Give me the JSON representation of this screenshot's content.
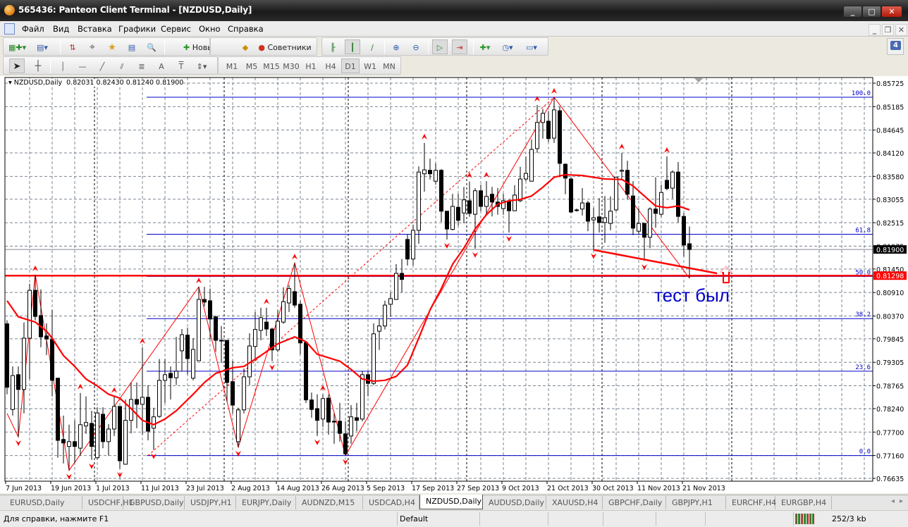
{
  "window": {
    "title": "565436: Panteon Client Terminal - [NZDUSD,Daily]",
    "minimize": "_",
    "maximize": "□",
    "close": "✕"
  },
  "menu": {
    "items": [
      "Файл",
      "Вид",
      "Вставка",
      "Графики",
      "Сервис",
      "Окно",
      "Справка"
    ],
    "mdi": [
      "_",
      "❐",
      "✕"
    ],
    "notification_count": "4"
  },
  "toolbar1": {
    "new_order": "Новый Ордер",
    "experts": "Советники"
  },
  "toolbar2": {
    "timeframes": [
      "M1",
      "M5",
      "M15",
      "M30",
      "H1",
      "H4",
      "D1",
      "W1",
      "MN"
    ],
    "active_timeframe": "D1",
    "text_tool": "A",
    "label_tool": "T"
  },
  "chart_header": {
    "symbol": "NZDUSD,Daily",
    "ohlc": "0.82031 0.82430 0.81240 0.81900"
  },
  "annotation": {
    "text": "тест был",
    "color": "#0000cc"
  },
  "tabs": [
    "EURUSD,Daily",
    "USDCHF,H1",
    "GBPUSD,Daily",
    "USDJPY,H1",
    "EURJPY,Daily",
    "AUDNZD,M15",
    "USDCAD,H4",
    "NZDUSD,Daily",
    "AUDUSD,Daily",
    "XAUUSD,H4",
    "GBPCHF,Daily",
    "GBPJPY,H1",
    "EURCHF,H4",
    "EURGBP,H4"
  ],
  "active_tab": "NZDUSD,Daily",
  "status": {
    "help": "Для справки, нажмите F1",
    "profile": "Default",
    "traffic": "252/3 kb"
  },
  "chart_data": {
    "type": "candlestick",
    "symbol": "NZDUSD",
    "timeframe": "Daily",
    "ylim": [
      0.76635,
      0.85725
    ],
    "y_ticks": [
      "0.85725",
      "0.85185",
      "0.84645",
      "0.84120",
      "0.83580",
      "0.83055",
      "0.82515",
      "0.81975",
      "0.81450",
      "0.80910",
      "0.80370",
      "0.79845",
      "0.79305",
      "0.78765",
      "0.78240",
      "0.77700",
      "0.77160",
      "0.76635"
    ],
    "x_labels": [
      {
        "bar": 0,
        "label": "7 Jun 2013"
      },
      {
        "bar": 8,
        "label": "19 Jun 2013"
      },
      {
        "bar": 16,
        "label": "1 Jul 2013"
      },
      {
        "bar": 24,
        "label": "11 Jul 2013"
      },
      {
        "bar": 32,
        "label": "23 Jul 2013"
      },
      {
        "bar": 40,
        "label": "2 Aug 2013"
      },
      {
        "bar": 48,
        "label": "14 Aug 2013"
      },
      {
        "bar": 56,
        "label": "26 Aug 2013"
      },
      {
        "bar": 64,
        "label": "5 Sep 2013"
      },
      {
        "bar": 72,
        "label": "17 Sep 2013"
      },
      {
        "bar": 80,
        "label": "27 Sep 2013"
      },
      {
        "bar": 88,
        "label": "9 Oct 2013"
      },
      {
        "bar": 96,
        "label": "21 Oct 2013"
      },
      {
        "bar": 104,
        "label": "30 Oct 2013"
      },
      {
        "bar": 112,
        "label": "11 Nov 2013"
      },
      {
        "bar": 120,
        "label": "21 Nov 2013"
      }
    ],
    "period_separator_bars": [
      16,
      39,
      61,
      82,
      106,
      129
    ],
    "ohlc": [
      [
        0.8019,
        0.8027,
        0.7857,
        0.7873
      ],
      [
        0.7822,
        0.7921,
        0.7808,
        0.79
      ],
      [
        0.7902,
        0.7921,
        0.7759,
        0.7868
      ],
      [
        0.7868,
        0.8022,
        0.7813,
        0.7986
      ],
      [
        0.7986,
        0.8111,
        0.7892,
        0.8096
      ],
      [
        0.8096,
        0.8132,
        0.8027,
        0.8036
      ],
      [
        0.8038,
        0.8098,
        0.7965,
        0.7989
      ],
      [
        0.7991,
        0.802,
        0.7947,
        0.7984
      ],
      [
        0.7983,
        0.8051,
        0.7852,
        0.7889
      ],
      [
        0.7894,
        0.7894,
        0.7711,
        0.7751
      ],
      [
        0.7753,
        0.7808,
        0.7698,
        0.7745
      ],
      [
        0.7737,
        0.7787,
        0.7682,
        0.7748
      ],
      [
        0.7748,
        0.7797,
        0.7699,
        0.7737
      ],
      [
        0.7733,
        0.786,
        0.7716,
        0.7787
      ],
      [
        0.7784,
        0.7852,
        0.7766,
        0.7792
      ],
      [
        0.779,
        0.7819,
        0.7706,
        0.7737
      ],
      [
        0.7711,
        0.7827,
        0.7707,
        0.7814
      ],
      [
        0.7811,
        0.7827,
        0.7733,
        0.7748
      ],
      [
        0.7748,
        0.7788,
        0.7716,
        0.7777
      ],
      [
        0.7777,
        0.7852,
        0.7761,
        0.7829
      ],
      [
        0.7829,
        0.7829,
        0.7686,
        0.7704
      ],
      [
        0.7696,
        0.7845,
        0.7695,
        0.7797
      ],
      [
        0.7797,
        0.7884,
        0.7767,
        0.7845
      ],
      [
        0.7845,
        0.7884,
        0.7779,
        0.7834
      ],
      [
        0.7834,
        0.7965,
        0.7764,
        0.785
      ],
      [
        0.785,
        0.7878,
        0.7751,
        0.7772
      ],
      [
        0.7779,
        0.7826,
        0.7729,
        0.7805
      ],
      [
        0.7806,
        0.7938,
        0.7803,
        0.7889
      ],
      [
        0.7889,
        0.7938,
        0.7837,
        0.7902
      ],
      [
        0.7905,
        0.7921,
        0.7845,
        0.7895
      ],
      [
        0.7895,
        0.7989,
        0.7878,
        0.791
      ],
      [
        0.7957,
        0.8007,
        0.791,
        0.7994
      ],
      [
        0.7993,
        0.801,
        0.7902,
        0.7939
      ],
      [
        0.7894,
        0.7986,
        0.7889,
        0.796
      ],
      [
        0.7934,
        0.8104,
        0.7934,
        0.8075
      ],
      [
        0.8075,
        0.8104,
        0.8059,
        0.8069
      ],
      [
        0.8072,
        0.81,
        0.7983,
        0.803
      ],
      [
        0.8035,
        0.8038,
        0.7955,
        0.7981
      ],
      [
        0.7981,
        0.8014,
        0.7929,
        0.798
      ],
      [
        0.7981,
        0.7981,
        0.784,
        0.7884
      ],
      [
        0.7886,
        0.7934,
        0.7813,
        0.7832
      ],
      [
        0.7748,
        0.7826,
        0.7735,
        0.7821
      ],
      [
        0.7821,
        0.7916,
        0.7813,
        0.7897
      ],
      [
        0.7897,
        0.7997,
        0.7878,
        0.7968
      ],
      [
        0.7967,
        0.8046,
        0.7933,
        0.8006
      ],
      [
        0.8004,
        0.8056,
        0.7981,
        0.8033
      ],
      [
        0.8023,
        0.8056,
        0.7991,
        0.8007
      ],
      [
        0.8007,
        0.801,
        0.7933,
        0.7959
      ],
      [
        0.7959,
        0.8051,
        0.7954,
        0.8025
      ],
      [
        0.8023,
        0.8103,
        0.8019,
        0.807
      ],
      [
        0.8067,
        0.8108,
        0.8046,
        0.81
      ],
      [
        0.8093,
        0.8159,
        0.8056,
        0.8062
      ],
      [
        0.8064,
        0.8072,
        0.7949,
        0.7975
      ],
      [
        0.7976,
        0.7978,
        0.7837,
        0.7844
      ],
      [
        0.7844,
        0.7861,
        0.7803,
        0.7822
      ],
      [
        0.7824,
        0.7857,
        0.7761,
        0.7797
      ],
      [
        0.78,
        0.7857,
        0.7782,
        0.7847
      ],
      [
        0.7848,
        0.7857,
        0.7764,
        0.7793
      ],
      [
        0.7795,
        0.7813,
        0.7743,
        0.7793
      ],
      [
        0.7795,
        0.7837,
        0.7748,
        0.7767
      ],
      [
        0.7766,
        0.7795,
        0.7716,
        0.772
      ],
      [
        0.7761,
        0.7832,
        0.7743,
        0.7805
      ],
      [
        0.7803,
        0.7837,
        0.7772,
        0.7797
      ],
      [
        0.78,
        0.791,
        0.7795,
        0.7902
      ],
      [
        0.7902,
        0.791,
        0.7852,
        0.7882
      ],
      [
        0.7882,
        0.802,
        0.7878,
        0.7996
      ],
      [
        0.8002,
        0.803,
        0.7959,
        0.8014
      ],
      [
        0.8014,
        0.8072,
        0.8006,
        0.8062
      ],
      [
        0.8064,
        0.809,
        0.8036,
        0.8077
      ],
      [
        0.8075,
        0.8156,
        0.8074,
        0.8135
      ],
      [
        0.8135,
        0.8168,
        0.8091,
        0.8121
      ],
      [
        0.8213,
        0.8224,
        0.8153,
        0.8168
      ],
      [
        0.8168,
        0.8247,
        0.8153,
        0.8234
      ],
      [
        0.8234,
        0.8381,
        0.8203,
        0.8368
      ],
      [
        0.8364,
        0.8435,
        0.8323,
        0.8373
      ],
      [
        0.8372,
        0.8399,
        0.8351,
        0.8364
      ],
      [
        0.8347,
        0.8388,
        0.8339,
        0.8372
      ],
      [
        0.8372,
        0.8375,
        0.8253,
        0.8278
      ],
      [
        0.8278,
        0.8278,
        0.8213,
        0.8237
      ],
      [
        0.8236,
        0.8318,
        0.8234,
        0.8289
      ],
      [
        0.8287,
        0.8318,
        0.8245,
        0.8257
      ],
      [
        0.8274,
        0.8334,
        0.825,
        0.8304
      ],
      [
        0.8302,
        0.8346,
        0.8265,
        0.8273
      ],
      [
        0.8271,
        0.8331,
        0.8192,
        0.8325
      ],
      [
        0.8325,
        0.8339,
        0.8278,
        0.8289
      ],
      [
        0.8289,
        0.8347,
        0.8273,
        0.8312
      ],
      [
        0.8317,
        0.8334,
        0.8266,
        0.8299
      ],
      [
        0.8299,
        0.8331,
        0.827,
        0.8289
      ],
      [
        0.8284,
        0.8318,
        0.827,
        0.8302
      ],
      [
        0.83,
        0.8305,
        0.8229,
        0.8279
      ],
      [
        0.8279,
        0.8338,
        0.8278,
        0.8315
      ],
      [
        0.8302,
        0.838,
        0.8299,
        0.8352
      ],
      [
        0.8352,
        0.8404,
        0.8347,
        0.8365
      ],
      [
        0.8347,
        0.8443,
        0.8346,
        0.842
      ],
      [
        0.8422,
        0.8522,
        0.8412,
        0.8482
      ],
      [
        0.8482,
        0.8513,
        0.8445,
        0.8503
      ],
      [
        0.8485,
        0.8508,
        0.8437,
        0.8445
      ],
      [
        0.8446,
        0.854,
        0.8435,
        0.8511
      ],
      [
        0.8509,
        0.8518,
        0.8356,
        0.8388
      ],
      [
        0.8386,
        0.8388,
        0.8317,
        0.8354
      ],
      [
        0.8352,
        0.8356,
        0.8274,
        0.8276
      ],
      [
        0.8281,
        0.8284,
        0.8277,
        0.8281
      ],
      [
        0.8283,
        0.8331,
        0.8268,
        0.8297
      ],
      [
        0.8297,
        0.8302,
        0.8232,
        0.8255
      ],
      [
        0.8258,
        0.8286,
        0.8189,
        0.8263
      ],
      [
        0.8265,
        0.8308,
        0.8229,
        0.8252
      ],
      [
        0.8252,
        0.8313,
        0.8205,
        0.8263
      ],
      [
        0.825,
        0.8312,
        0.8234,
        0.8278
      ],
      [
        0.8281,
        0.8356,
        0.8278,
        0.8356
      ],
      [
        0.837,
        0.8412,
        0.8351,
        0.8372
      ],
      [
        0.8372,
        0.8394,
        0.8305,
        0.8317
      ],
      [
        0.8313,
        0.8347,
        0.8223,
        0.8239
      ],
      [
        0.8232,
        0.8284,
        0.8224,
        0.825
      ],
      [
        0.825,
        0.825,
        0.8164,
        0.8218
      ],
      [
        0.8218,
        0.8287,
        0.8193,
        0.8283
      ],
      [
        0.8283,
        0.8356,
        0.824,
        0.8273
      ],
      [
        0.8271,
        0.8339,
        0.8265,
        0.8321
      ],
      [
        0.8349,
        0.8404,
        0.8326,
        0.833
      ],
      [
        0.8331,
        0.8372,
        0.8307,
        0.8368
      ],
      [
        0.8368,
        0.8391,
        0.8252,
        0.8266
      ],
      [
        0.8266,
        0.8274,
        0.8174,
        0.82
      ],
      [
        0.82031,
        0.8243,
        0.8124,
        0.819
      ]
    ],
    "moving_average": [
      [
        0,
        0.8072
      ],
      [
        2,
        0.8035
      ],
      [
        5,
        0.8023
      ],
      [
        7,
        0.8002
      ],
      [
        8,
        0.7986
      ],
      [
        10,
        0.7946
      ],
      [
        12,
        0.7921
      ],
      [
        14,
        0.7892
      ],
      [
        16,
        0.7876
      ],
      [
        18,
        0.7857
      ],
      [
        20,
        0.7848
      ],
      [
        22,
        0.7824
      ],
      [
        24,
        0.7797
      ],
      [
        26,
        0.7787
      ],
      [
        28,
        0.78
      ],
      [
        30,
        0.7819
      ],
      [
        33,
        0.7857
      ],
      [
        35,
        0.7884
      ],
      [
        37,
        0.7905
      ],
      [
        40,
        0.7918
      ],
      [
        42,
        0.7921
      ],
      [
        45,
        0.7946
      ],
      [
        48,
        0.7973
      ],
      [
        51,
        0.7989
      ],
      [
        53,
        0.7978
      ],
      [
        55,
        0.7949
      ],
      [
        59,
        0.7933
      ],
      [
        61,
        0.7914
      ],
      [
        63,
        0.7892
      ],
      [
        65,
        0.7887
      ],
      [
        67,
        0.7889
      ],
      [
        69,
        0.7898
      ],
      [
        71,
        0.7924
      ],
      [
        73,
        0.7986
      ],
      [
        75,
        0.8051
      ],
      [
        77,
        0.81
      ],
      [
        79,
        0.8156
      ],
      [
        81,
        0.8193
      ],
      [
        83,
        0.8237
      ],
      [
        85,
        0.827
      ],
      [
        87,
        0.8294
      ],
      [
        89,
        0.8302
      ],
      [
        91,
        0.8305
      ],
      [
        93,
        0.8313
      ],
      [
        95,
        0.8333
      ],
      [
        97,
        0.8356
      ],
      [
        99,
        0.8362
      ],
      [
        102,
        0.836
      ],
      [
        106,
        0.8352
      ],
      [
        109,
        0.8351
      ],
      [
        111,
        0.8336
      ],
      [
        113,
        0.8313
      ],
      [
        115,
        0.829
      ],
      [
        117,
        0.8286
      ],
      [
        119,
        0.829
      ],
      [
        121,
        0.8281
      ]
    ],
    "fibonacci": {
      "from_bar": 25,
      "levels": [
        {
          "label": "100.0",
          "price": 0.854
        },
        {
          "label": "61.8",
          "price": 0.8225
        },
        {
          "label": "50.0",
          "price": 0.8128
        },
        {
          "label": "38.2",
          "price": 0.8031
        },
        {
          "label": "23.6",
          "price": 0.791
        },
        {
          "label": "0.0",
          "price": 0.7716
        }
      ]
    },
    "fib_trend_line": [
      [
        25,
        0.7716
      ],
      [
        97,
        0.854
      ]
    ],
    "zigzag": [
      [
        0,
        0.7813
      ],
      [
        2,
        0.7759
      ],
      [
        5,
        0.8132
      ],
      [
        11,
        0.7682
      ],
      [
        34,
        0.8104
      ],
      [
        41,
        0.7735
      ],
      [
        51,
        0.8159
      ],
      [
        60,
        0.7716
      ],
      [
        97,
        0.854
      ],
      [
        121,
        0.8124
      ]
    ],
    "support_trendline": [
      [
        104,
        0.8189
      ],
      [
        125.9,
        0.8135
      ]
    ],
    "horizontal_level": {
      "price": 0.81298,
      "label": "0.81298",
      "color": "#ff0000"
    },
    "bid": {
      "price": 0.819,
      "label": "0.81900"
    },
    "price_arrow": {
      "bar": 127.5,
      "price": 0.813
    },
    "fractals_up": [
      5,
      13,
      19,
      24,
      34,
      46,
      51,
      56,
      74,
      82,
      85,
      94,
      97,
      109,
      117
    ],
    "fractals_down": [
      2,
      11,
      15,
      20,
      26,
      41,
      47,
      55,
      60,
      78,
      83,
      89,
      104,
      113
    ]
  }
}
